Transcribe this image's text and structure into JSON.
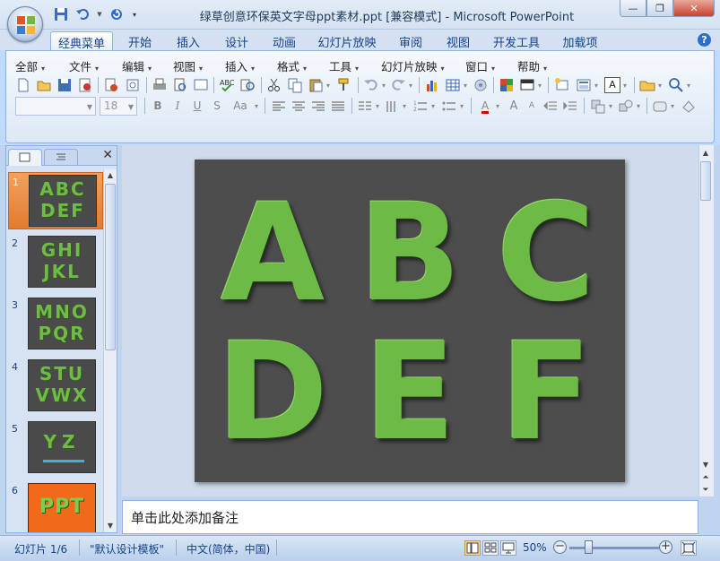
{
  "window": {
    "title": "绿草创意环保英文字母ppt素材.ppt [兼容模式] - Microsoft PowerPoint",
    "minimize": "—",
    "restore": "❐",
    "close": "✕"
  },
  "ribbon_tabs": [
    "经典菜单",
    "开始",
    "插入",
    "设计",
    "动画",
    "幻灯片放映",
    "审阅",
    "视图",
    "开发工具",
    "加载项"
  ],
  "menus": [
    "全部",
    "文件",
    "编辑",
    "视图",
    "插入",
    "格式",
    "工具",
    "幻灯片放映",
    "窗口",
    "帮助"
  ],
  "font_size_value": "18",
  "format_labels": {
    "bold": "B",
    "italic": "I",
    "underline": "U",
    "shadow": "S",
    "case": "Aa"
  },
  "help": "?",
  "slides": [
    {
      "num": "1",
      "text": "ABC DEF"
    },
    {
      "num": "2",
      "text": "GHI JKL"
    },
    {
      "num": "3",
      "text": "MNO PQR"
    },
    {
      "num": "4",
      "text": "STU VWX"
    },
    {
      "num": "5",
      "text": "YZ"
    },
    {
      "num": "6",
      "text": "PPT"
    }
  ],
  "current_slide_letters": [
    "A",
    "B",
    "C",
    "D",
    "E",
    "F"
  ],
  "notes_placeholder": "单击此处添加备注",
  "status": {
    "slide_counter": "幻灯片 1/6",
    "theme": "\"默认设计模板\"",
    "language": "中文(简体，中国)",
    "zoom": "50%"
  },
  "colors": {
    "slide_background": "#4d4d4d",
    "grass_green": "#6dbb46",
    "selected_thumb": "#e07b30",
    "thumb6_background": "#f06a1a"
  }
}
